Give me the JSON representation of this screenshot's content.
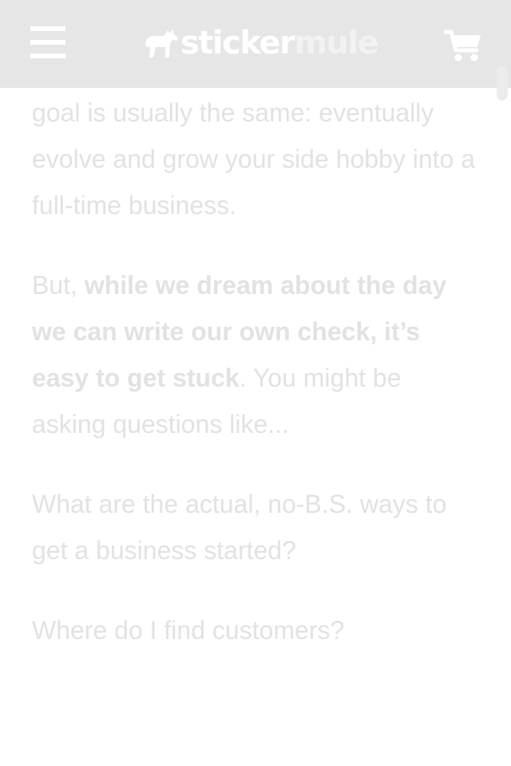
{
  "header": {
    "logo_word_1": "sticker",
    "logo_word_2": "mule",
    "menu_icon": "hamburger-menu-icon",
    "logo_icon": "mule-logo-icon",
    "cart_icon": "shopping-cart-icon",
    "background_color": "#e6e6e6"
  },
  "article": {
    "para1": "goal is usually the same: eventually evolve and grow your side hobby into a full-time business.",
    "para2_prefix": "But, ",
    "para2_bold": "while we dream about the day we can write our own check, it’s easy to get stuck",
    "para2_suffix": ". You might be asking questions like...",
    "question1": "What are the actual, no-B.S. ways to get a business started?",
    "question2": "Where do I find customers?",
    "text_color": "#e2e2e2"
  }
}
